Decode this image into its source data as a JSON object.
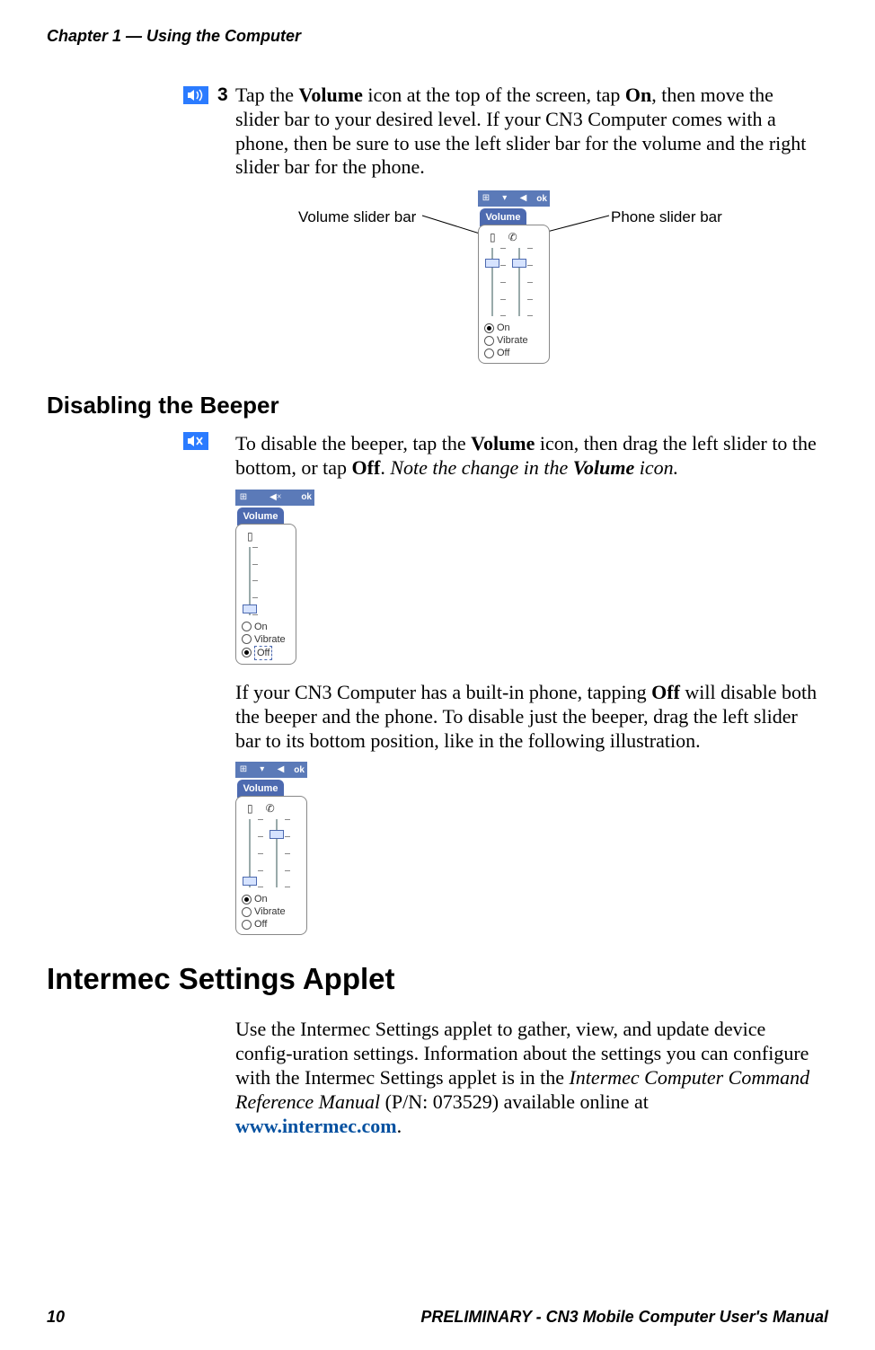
{
  "header": {
    "chapter": "Chapter 1 — Using the Computer"
  },
  "step3": {
    "num": "3",
    "p1a": "Tap the ",
    "p1b": "Volume",
    "p1c": " icon at the top of the screen, tap ",
    "p1d": "On",
    "p1e": ", then move the slider bar to your desired level. If your CN3 Computer comes with a phone, then be sure to use the left slider bar for the volume and the right slider bar for the phone.",
    "label_left": "Volume slider bar",
    "label_right": "Phone slider bar"
  },
  "ui": {
    "volume_tab": "Volume",
    "ok": "ok",
    "radio_on": "On",
    "radio_vibrate": "Vibrate",
    "radio_off": "Off"
  },
  "disable": {
    "heading": "Disabling the Beeper",
    "p1a": "To disable the beeper, tap the ",
    "p1b": "Volume",
    "p1c": " icon, then drag the left slider to the bottom, or tap ",
    "p1d": "Off",
    "p1e": ". ",
    "p1f": "Note the change in the ",
    "p1g": "Volume",
    "p1h": " icon.",
    "p2a": "If your CN3 Computer has a built-in phone, tapping ",
    "p2b": "Off",
    "p2c": " will disable both the beeper and the phone. To disable just the beeper, drag the left slider bar to its bottom position, like in the following illustration."
  },
  "applet": {
    "heading": "Intermec Settings Applet",
    "p1a": "Use the Intermec Settings applet to gather, view, and update device config-uration settings. Information about the settings you can configure with the Intermec Settings applet is in the ",
    "p1b": "Intermec Computer Command Reference Manual",
    "p1c": " (P/N: 073529) available online at ",
    "link": "www.intermec.com",
    "p1d": "."
  },
  "footer": {
    "page": "10",
    "title": "PRELIMINARY - CN3 Mobile Computer User's Manual"
  }
}
